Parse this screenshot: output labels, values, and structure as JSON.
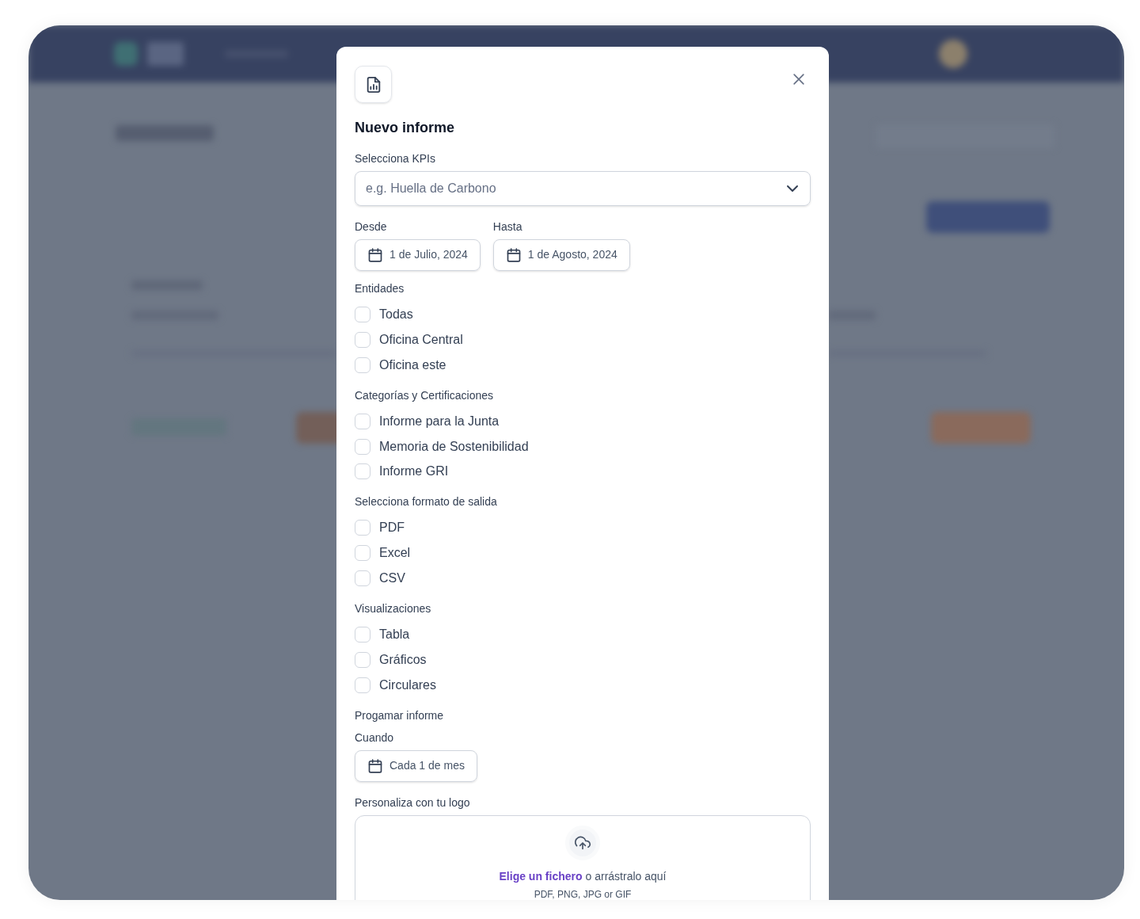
{
  "dialog": {
    "title": "Nuevo informe"
  },
  "kpi_field": {
    "label": "Selecciona KPIs",
    "placeholder": "e.g. Huella de Carbono"
  },
  "date_range": [
    {
      "label": "Desde",
      "value": "1 de Julio, 2024"
    },
    {
      "label": "Hasta",
      "value": "1 de Agosto, 2024"
    }
  ],
  "groups": [
    {
      "title": "Entidades",
      "options": [
        {
          "label": "Todas",
          "checked": false
        },
        {
          "label": "Oficina Central",
          "checked": false
        },
        {
          "label": "Oficina este",
          "checked": false
        }
      ]
    },
    {
      "title": "Categorías y Certificaciones",
      "options": [
        {
          "label": "Informe para la Junta",
          "checked": false
        },
        {
          "label": "Memoria de Sostenibilidad",
          "checked": false
        },
        {
          "label": "Informe GRI",
          "checked": false
        }
      ]
    },
    {
      "title": "Selecciona formato de salida",
      "options": [
        {
          "label": "PDF",
          "checked": false
        },
        {
          "label": "Excel",
          "checked": false
        },
        {
          "label": "CSV",
          "checked": false
        }
      ]
    },
    {
      "title": "Visualizaciones",
      "options": [
        {
          "label": "Tabla",
          "checked": false
        },
        {
          "label": "Gráficos",
          "checked": false
        },
        {
          "label": "Circulares",
          "checked": false
        }
      ]
    }
  ],
  "schedule": {
    "title": "Progamar informe",
    "label": "Cuando",
    "value": "Cada 1 de mes"
  },
  "logo_upload": {
    "title": "Personaliza con tu logo",
    "link": "Elige un fichero",
    "text": "o arrástralo aquí",
    "hint": "PDF, PNG, JPG or GIF"
  }
}
